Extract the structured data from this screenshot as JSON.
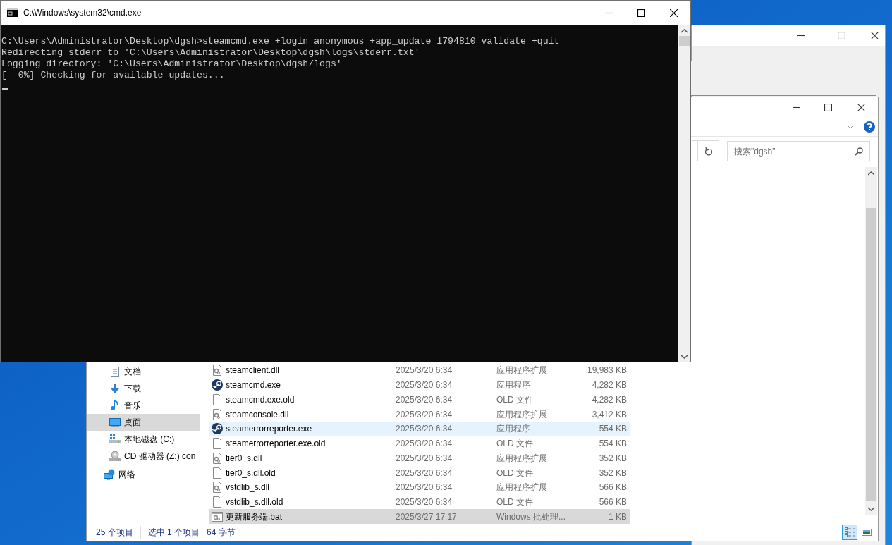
{
  "cmd_window": {
    "title": "C:\\Windows\\system32\\cmd.exe",
    "lines": [
      "C:\\Users\\Administrator\\Desktop\\dgsh>steamcmd.exe +login anonymous +app_update 1794810 validate +quit",
      "Redirecting stderr to 'C:\\Users\\Administrator\\Desktop\\dgsh\\logs\\stderr.txt'",
      "Logging directory: 'C:\\Users\\Administrator\\Desktop\\dgsh/logs'",
      "[  0%] Checking for available updates..."
    ]
  },
  "explorer": {
    "search": {
      "placeholder": "搜索\"dgsh\""
    },
    "nav_items": [
      {
        "label": "文档",
        "kind": "document",
        "selected": false
      },
      {
        "label": "下载",
        "kind": "download",
        "selected": false
      },
      {
        "label": "音乐",
        "kind": "music",
        "selected": false
      },
      {
        "label": "桌面",
        "kind": "desktop",
        "selected": true
      },
      {
        "label": "本地磁盘 (C:)",
        "kind": "drive",
        "selected": false
      },
      {
        "label": "CD 驱动器 (Z:) con",
        "kind": "cd",
        "selected": false
      },
      {
        "label": "网络",
        "kind": "network",
        "selected": false
      }
    ],
    "files": [
      {
        "name": "steamclient.dll",
        "date": "2025/3/20 6:34",
        "type": "应用程序扩展",
        "size": "19,983 KB",
        "kind": "dll",
        "selected": false,
        "hovered": false
      },
      {
        "name": "steamcmd.exe",
        "date": "2025/3/20 6:34",
        "type": "应用程序",
        "size": "4,282 KB",
        "kind": "steam",
        "selected": false,
        "hovered": false
      },
      {
        "name": "steamcmd.exe.old",
        "date": "2025/3/20 6:34",
        "type": "OLD 文件",
        "size": "4,282 KB",
        "kind": "blank",
        "selected": false,
        "hovered": false
      },
      {
        "name": "steamconsole.dll",
        "date": "2025/3/20 6:34",
        "type": "应用程序扩展",
        "size": "3,412 KB",
        "kind": "dll",
        "selected": false,
        "hovered": false
      },
      {
        "name": "steamerrorreporter.exe",
        "date": "2025/3/20 6:34",
        "type": "应用程序",
        "size": "554 KB",
        "kind": "steam",
        "selected": false,
        "hovered": true
      },
      {
        "name": "steamerrorreporter.exe.old",
        "date": "2025/3/20 6:34",
        "type": "OLD 文件",
        "size": "554 KB",
        "kind": "blank",
        "selected": false,
        "hovered": false
      },
      {
        "name": "tier0_s.dll",
        "date": "2025/3/20 6:34",
        "type": "应用程序扩展",
        "size": "352 KB",
        "kind": "dll",
        "selected": false,
        "hovered": false
      },
      {
        "name": "tier0_s.dll.old",
        "date": "2025/3/20 6:34",
        "type": "OLD 文件",
        "size": "352 KB",
        "kind": "blank",
        "selected": false,
        "hovered": false
      },
      {
        "name": "vstdlib_s.dll",
        "date": "2025/3/20 6:34",
        "type": "应用程序扩展",
        "size": "566 KB",
        "kind": "dll",
        "selected": false,
        "hovered": false
      },
      {
        "name": "vstdlib_s.dll.old",
        "date": "2025/3/20 6:34",
        "type": "OLD 文件",
        "size": "566 KB",
        "kind": "blank",
        "selected": false,
        "hovered": false
      },
      {
        "name": "更新服务端.bat",
        "date": "2025/3/27 17:17",
        "type": "Windows 批处理...",
        "size": "1 KB",
        "kind": "bat",
        "selected": true,
        "hovered": false
      }
    ],
    "status_bar": [
      "25 个项目",
      "选中 1 个项目",
      "64 字节"
    ],
    "view_buttons": [
      {
        "kind": "details",
        "selected": true
      },
      {
        "kind": "preview",
        "selected": false
      }
    ]
  }
}
